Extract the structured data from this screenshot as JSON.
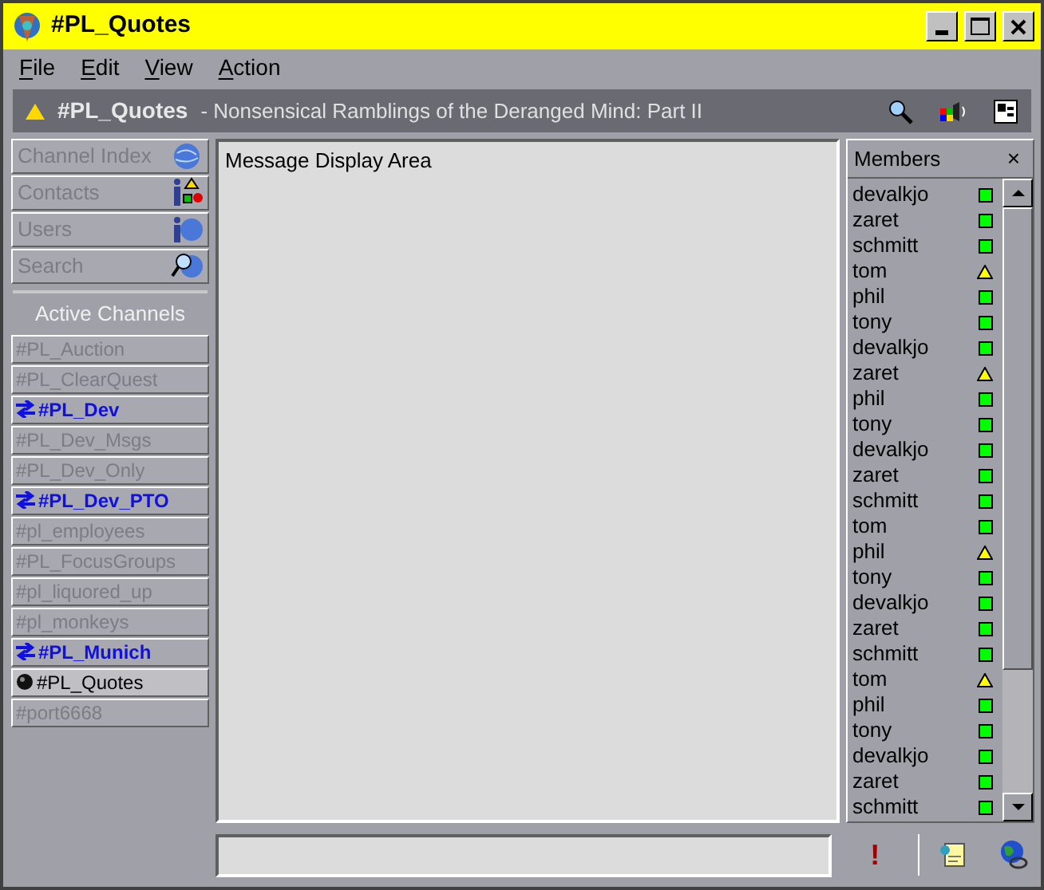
{
  "window": {
    "title": "#PL_Quotes"
  },
  "menu": [
    "File",
    "Edit",
    "View",
    "Action"
  ],
  "channel_header": {
    "name": "#PL_Quotes",
    "topic": "- Nonsensical Ramblings of the Deranged Mind: Part II"
  },
  "nav": [
    "Channel Index",
    "Contacts",
    "Users",
    "Search"
  ],
  "active_channels": {
    "heading": "Active Channels",
    "items": [
      {
        "label": "#PL_Auction",
        "selected": false,
        "activity": false
      },
      {
        "label": "#PL_ClearQuest",
        "selected": false,
        "activity": false
      },
      {
        "label": "#PL_Dev",
        "selected": false,
        "activity": true
      },
      {
        "label": "#PL_Dev_Msgs",
        "selected": false,
        "activity": false
      },
      {
        "label": "#PL_Dev_Only",
        "selected": false,
        "activity": false
      },
      {
        "label": "#PL_Dev_PTO",
        "selected": false,
        "activity": true
      },
      {
        "label": "#pl_employees",
        "selected": false,
        "activity": false
      },
      {
        "label": "#PL_FocusGroups",
        "selected": false,
        "activity": false
      },
      {
        "label": "#pl_liquored_up",
        "selected": false,
        "activity": false
      },
      {
        "label": "#pl_monkeys",
        "selected": false,
        "activity": false
      },
      {
        "label": "#PL_Munich",
        "selected": false,
        "activity": true
      },
      {
        "label": "#PL_Quotes",
        "selected": true,
        "activity": false
      },
      {
        "label": "#port6668",
        "selected": false,
        "activity": false
      }
    ]
  },
  "message_area": {
    "text": "Message Display Area"
  },
  "members": {
    "title": "Members",
    "close": "×",
    "items": [
      {
        "name": "devalkjo",
        "kind": "online"
      },
      {
        "name": "zaret",
        "kind": "online"
      },
      {
        "name": "schmitt",
        "kind": "online"
      },
      {
        "name": "tom",
        "kind": "away"
      },
      {
        "name": "phil",
        "kind": "online"
      },
      {
        "name": "tony",
        "kind": "online"
      },
      {
        "name": "devalkjo",
        "kind": "online"
      },
      {
        "name": "zaret",
        "kind": "away"
      },
      {
        "name": "phil",
        "kind": "online"
      },
      {
        "name": "tony",
        "kind": "online"
      },
      {
        "name": "devalkjo",
        "kind": "online"
      },
      {
        "name": "zaret",
        "kind": "online"
      },
      {
        "name": "schmitt",
        "kind": "online"
      },
      {
        "name": "tom",
        "kind": "online"
      },
      {
        "name": "phil",
        "kind": "away"
      },
      {
        "name": "tony",
        "kind": "online"
      },
      {
        "name": "devalkjo",
        "kind": "online"
      },
      {
        "name": "zaret",
        "kind": "online"
      },
      {
        "name": "schmitt",
        "kind": "online"
      },
      {
        "name": "tom",
        "kind": "away"
      },
      {
        "name": "phil",
        "kind": "online"
      },
      {
        "name": "tony",
        "kind": "online"
      },
      {
        "name": "devalkjo",
        "kind": "online"
      },
      {
        "name": "zaret",
        "kind": "online"
      },
      {
        "name": "schmitt",
        "kind": "online"
      }
    ]
  },
  "input": {
    "alert": "!"
  }
}
